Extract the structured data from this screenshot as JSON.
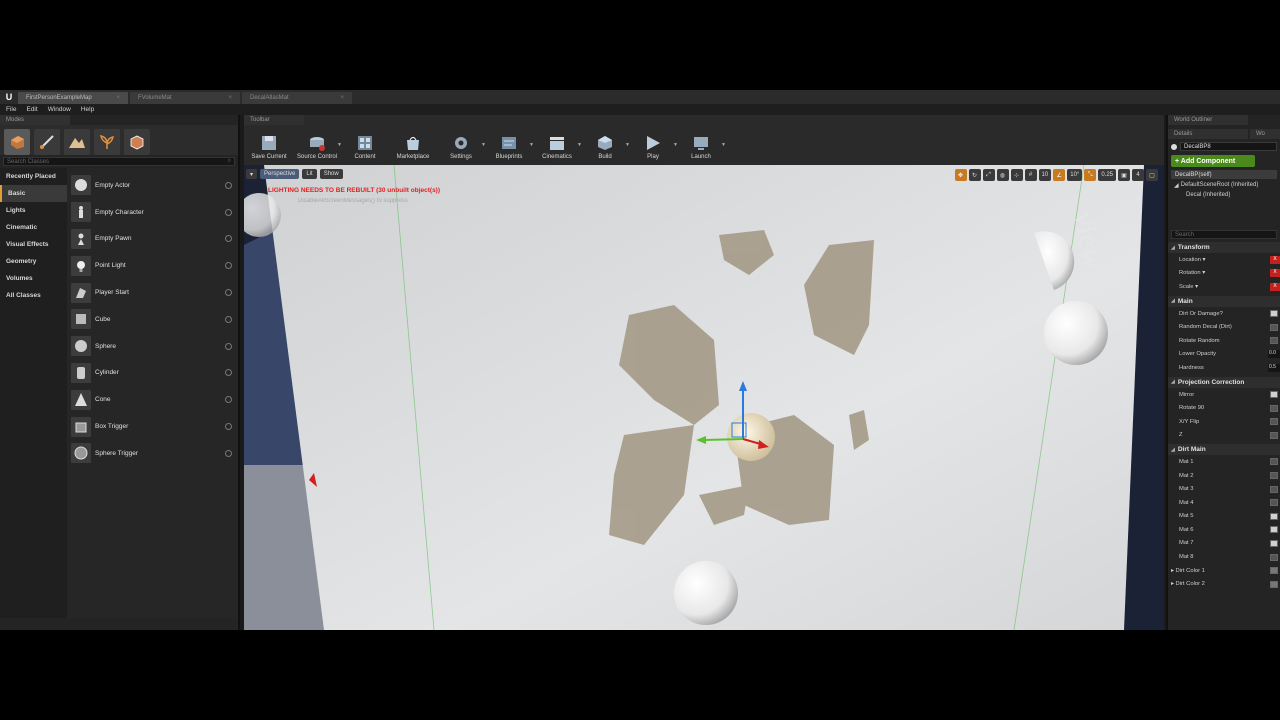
{
  "tabs": [
    {
      "label": "FirstPersonExampleMap",
      "active": true
    },
    {
      "label": "FVolumeMat",
      "active": false
    },
    {
      "label": "DecalAtlasMat",
      "active": false
    }
  ],
  "menu": [
    "File",
    "Edit",
    "Window",
    "Help"
  ],
  "modes": {
    "tab": "Modes",
    "search_placeholder": "Search Classes",
    "categories": [
      "Recently Placed",
      "Basic",
      "Lights",
      "Cinematic",
      "Visual Effects",
      "Geometry",
      "Volumes",
      "All Classes"
    ],
    "active_category": "Basic",
    "items": [
      "Empty Actor",
      "Empty Character",
      "Empty Pawn",
      "Point Light",
      "Player Start",
      "Cube",
      "Sphere",
      "Cylinder",
      "Cone",
      "Box Trigger",
      "Sphere Trigger"
    ]
  },
  "toolbar": {
    "tab": "Toolbar",
    "buttons": [
      "Save Current",
      "Source Control",
      "Content",
      "Marketplace",
      "Settings",
      "Blueprints",
      "Cinematics",
      "Build",
      "Play",
      "Launch"
    ]
  },
  "viewport": {
    "perspective": "Perspective",
    "lit": "Lit",
    "show": "Show",
    "warning": "LIGHTING NEEDS TO BE REBUILT (30 unbuilt object(s))",
    "warning_sub": "DisableAllScreenMessages() to suppress",
    "grid_snap": "10",
    "rot_snap": "10°",
    "scale_snap": "0.25",
    "cam_speed": "4",
    "watermark": "view"
  },
  "outliner": {
    "tab": "World Outliner"
  },
  "details": {
    "tab": "Details",
    "tab2": "Wo",
    "name": "DecalBP8",
    "add_component": "+ Add Component",
    "self": "DecalBP(self)",
    "components": [
      "DefaultSceneRoot (Inherited)",
      "Decal (Inherited)"
    ],
    "search_placeholder": "Search",
    "transform": {
      "title": "Transform",
      "props": [
        "Location",
        "Rotation",
        "Scale"
      ],
      "axis": "X"
    },
    "main": {
      "title": "Main",
      "props": [
        {
          "label": "Dirt Or Damage?",
          "type": "check",
          "checked": true
        },
        {
          "label": "Random Decal (Dirt)",
          "type": "check",
          "checked": false
        },
        {
          "label": "Rotate Random",
          "type": "check",
          "checked": false
        },
        {
          "label": "Lower Opacity",
          "type": "num",
          "value": "0.0"
        },
        {
          "label": "Hardness",
          "type": "num",
          "value": "0.5"
        }
      ]
    },
    "projection": {
      "title": "Projection Correction",
      "props": [
        {
          "label": "Mirror",
          "checked": true
        },
        {
          "label": "Rotate 90",
          "checked": false
        },
        {
          "label": "X/Y Flip",
          "checked": false
        },
        {
          "label": "Z",
          "checked": false
        }
      ]
    },
    "dirt_main": {
      "title": "Dirt Main",
      "props": [
        {
          "label": "Mat 1",
          "checked": false
        },
        {
          "label": "Mat 2",
          "checked": false
        },
        {
          "label": "Mat 3",
          "checked": false
        },
        {
          "label": "Mat 4",
          "checked": false
        },
        {
          "label": "Mat 5",
          "checked": true
        },
        {
          "label": "Mat 6",
          "checked": true
        },
        {
          "label": "Mat 7",
          "checked": true
        },
        {
          "label": "Mat 8",
          "checked": false
        }
      ],
      "colors": [
        "Dirt Color 1",
        "Dirt Color 2"
      ]
    }
  }
}
